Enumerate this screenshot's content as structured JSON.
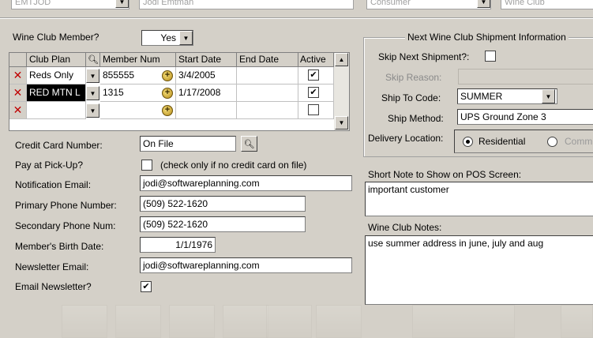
{
  "top_bar": {
    "field1": "EMTJOD",
    "field2": "Jodi Emtman",
    "field3": "Consumer",
    "field4": "Wine Club"
  },
  "wine_club_member": {
    "label": "Wine Club Member?",
    "value": "Yes"
  },
  "grid": {
    "headers": [
      "Club Plan",
      "Member Num",
      "Start Date",
      "End Date",
      "Active"
    ],
    "rows": [
      {
        "plan": "Reds Only",
        "member_num": "855555",
        "start": "3/4/2005",
        "end": "",
        "active": "✔"
      },
      {
        "plan": "RED MTN L",
        "member_num": "1315",
        "start": "1/17/2008",
        "end": "",
        "active": "✔"
      },
      {
        "plan": "",
        "member_num": "",
        "start": "",
        "end": "",
        "active": ""
      }
    ]
  },
  "credit_card": {
    "label": "Credit Card Number:",
    "value": "On File"
  },
  "pay_pickup": {
    "label": "Pay at Pick-Up?",
    "note": "(check only if no credit card on file)"
  },
  "notification_email": {
    "label": "Notification Email:",
    "value": "jodi@softwareplanning.com"
  },
  "primary_phone": {
    "label": "Primary Phone Number:",
    "value": "(509) 522-1620"
  },
  "secondary_phone": {
    "label": "Secondary Phone Num:",
    "value": "(509) 522-1620"
  },
  "birth_date": {
    "label": "Member's Birth Date:",
    "value": "1/1/1976"
  },
  "newsletter_email": {
    "label": "Newsletter Email:",
    "value": "jodi@softwareplanning.com"
  },
  "email_newsletter": {
    "label": "Email Newsletter?",
    "value": "✔"
  },
  "shipment": {
    "title": "Next Wine Club Shipment Information",
    "skip_label": "Skip Next Shipment?:",
    "skip_reason_label": "Skip Reason:",
    "ship_to_label": "Ship To Code:",
    "ship_to_value": "SUMMER",
    "ship_method_label": "Ship Method:",
    "ship_method_value": "UPS Ground Zone 3",
    "delivery_label": "Delivery Location:",
    "residential": "Residential",
    "commercial": "Comm"
  },
  "short_note": {
    "label": "Short Note to Show on POS Screen:",
    "value": "important customer"
  },
  "wine_club_notes": {
    "label": "Wine Club Notes:",
    "value": "use summer address in june, july and aug"
  },
  "icons": {
    "delete": "delete-x-icon",
    "search": "magnifier-icon",
    "add": "plus-coin-icon",
    "dropdown": "triangle-down-icon"
  }
}
